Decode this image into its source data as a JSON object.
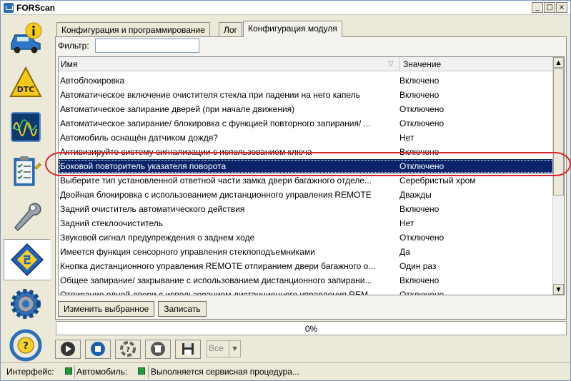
{
  "window": {
    "title": "FORScan",
    "controls": [
      "_",
      "□",
      "×"
    ]
  },
  "sidebar": {
    "items": [
      {
        "name": "vehicle-info",
        "icon": "car-info-icon"
      },
      {
        "name": "dtc",
        "icon": "dtc-warning-icon"
      },
      {
        "name": "oscilloscope",
        "icon": "oscilloscope-icon"
      },
      {
        "name": "tests",
        "icon": "checklist-icon"
      },
      {
        "name": "service",
        "icon": "wrench-icon"
      },
      {
        "name": "configuration",
        "icon": "chip-icon",
        "active": true
      },
      {
        "name": "settings",
        "icon": "gear-icon"
      },
      {
        "name": "help",
        "icon": "help-steering-icon"
      }
    ]
  },
  "tabs": [
    {
      "label": "Конфигурация и программирование",
      "active": false
    },
    {
      "label": "Лог",
      "active": false
    },
    {
      "label": "Конфигурация модуля",
      "active": true
    }
  ],
  "filter": {
    "label": "Фильтр:",
    "value": "",
    "placeholder": ""
  },
  "table": {
    "columns": [
      "Имя",
      "Значение"
    ],
    "rows": [
      {
        "name": "Автоблокировка",
        "value": "Включено"
      },
      {
        "name": "Автоматическое включение очистителя стекла при падении на него капель",
        "value": "Включено"
      },
      {
        "name": "Автоматическое запирание дверей (при начале движения)",
        "value": "Отключено"
      },
      {
        "name": "Автоматическое запирание/ блокировка с функцией повторного запирания/ ...",
        "value": "Отключено"
      },
      {
        "name": "Автомобиль оснащён датчиком дождя?",
        "value": "Нет"
      },
      {
        "name": "Активизируйте систему сигнализации с использованием ключа",
        "value": "Включено"
      },
      {
        "name": "Боковой повторитель указателя поворота",
        "value": "Отключено",
        "selected": true
      },
      {
        "name": "Выберите тип установленной ответной части замка двери багажного отделе...",
        "value": "Серебристый хром"
      },
      {
        "name": "Двойная блокировка с использованием дистанционного управления REMOTE",
        "value": "Дважды"
      },
      {
        "name": "Задний очиститель автоматического действия",
        "value": "Включено"
      },
      {
        "name": "Задний стеклоочиститель",
        "value": "Нет"
      },
      {
        "name": "Звуковой сигнал предупреждения о заднем ходе",
        "value": "Отключено"
      },
      {
        "name": "Имеется функция сенсорного управления стеклоподъемниками",
        "value": "Да"
      },
      {
        "name": "Кнопка дистанционного управления REMOTE отпиранием двери багажного о...",
        "value": "Один раз"
      },
      {
        "name": "Общее запирание/ закрывание с использованием дистанционного запирани...",
        "value": "Включено"
      },
      {
        "name": "Отпирание одной двери с использованием дистанционного управления REM...",
        "value": "Отключено"
      }
    ]
  },
  "buttons": {
    "edit_selected": "Изменить выбранное",
    "write": "Записать"
  },
  "progress": {
    "value": 0,
    "text": "0%"
  },
  "toolbar": {
    "items": [
      "play-icon",
      "stop-icon",
      "lifebuoy-icon",
      "trash-icon",
      "save-icon"
    ],
    "combo_value": "Все"
  },
  "status": {
    "interface_label": "Интерфейс:",
    "vehicle_label": "Автомобиль:",
    "message": "Выполняется сервисная процедура...",
    "led_color": "#1f9a3a"
  },
  "colors": {
    "selection": "#0a246a",
    "annotation": "#d9262b"
  }
}
